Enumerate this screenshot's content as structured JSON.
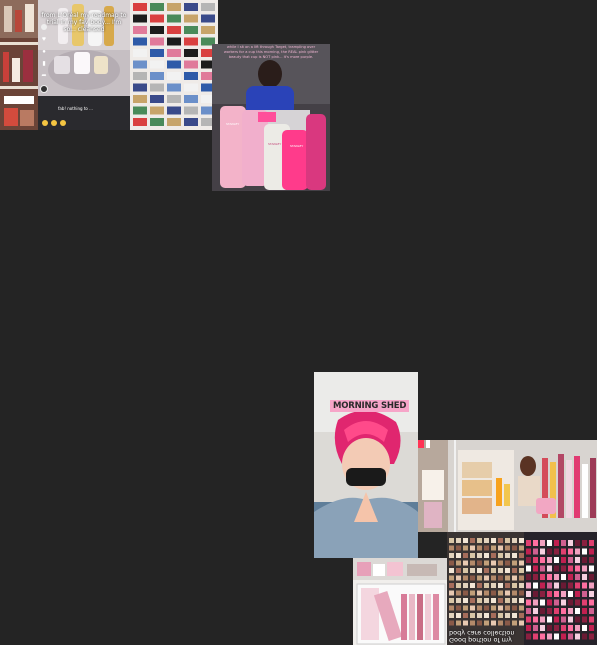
{
  "canvas": {
    "background": "#242424"
  },
  "tiles": {
    "skincare_shelf": {
      "caption": "",
      "accent": "#c98f7a"
    },
    "tiktok_post": {
      "caption": "from L'Oréal my roadmap to trial in my fav body... I'm so... cleansed",
      "footer": "fab! nothing to ...",
      "side_icons": [
        "avatar-icon",
        "heart-icon",
        "comment-icon",
        "bookmark-icon",
        "share-icon",
        "music-disc-icon"
      ]
    },
    "shoe_wall": {
      "caption": ""
    },
    "cups_video": {
      "caption": "while I sit on a lift through Target, trampling over workers for a cup this morning, the REAL pink glitter beauty that cup is NOT pink... it's more purple.",
      "cup_brand": "STANLEY",
      "accent": "#e8338b"
    },
    "morning_shed": {
      "title": "MORNING SHED",
      "title_bg": "#f6a5c8",
      "hair": "#e0266f"
    },
    "makeup_drawer": {
      "caption": ""
    },
    "nail_polish": {
      "caption": "Good portion of my body care collection"
    },
    "bodycare_shelf": {
      "caption": ""
    },
    "polish_wall": {
      "caption": ""
    }
  }
}
